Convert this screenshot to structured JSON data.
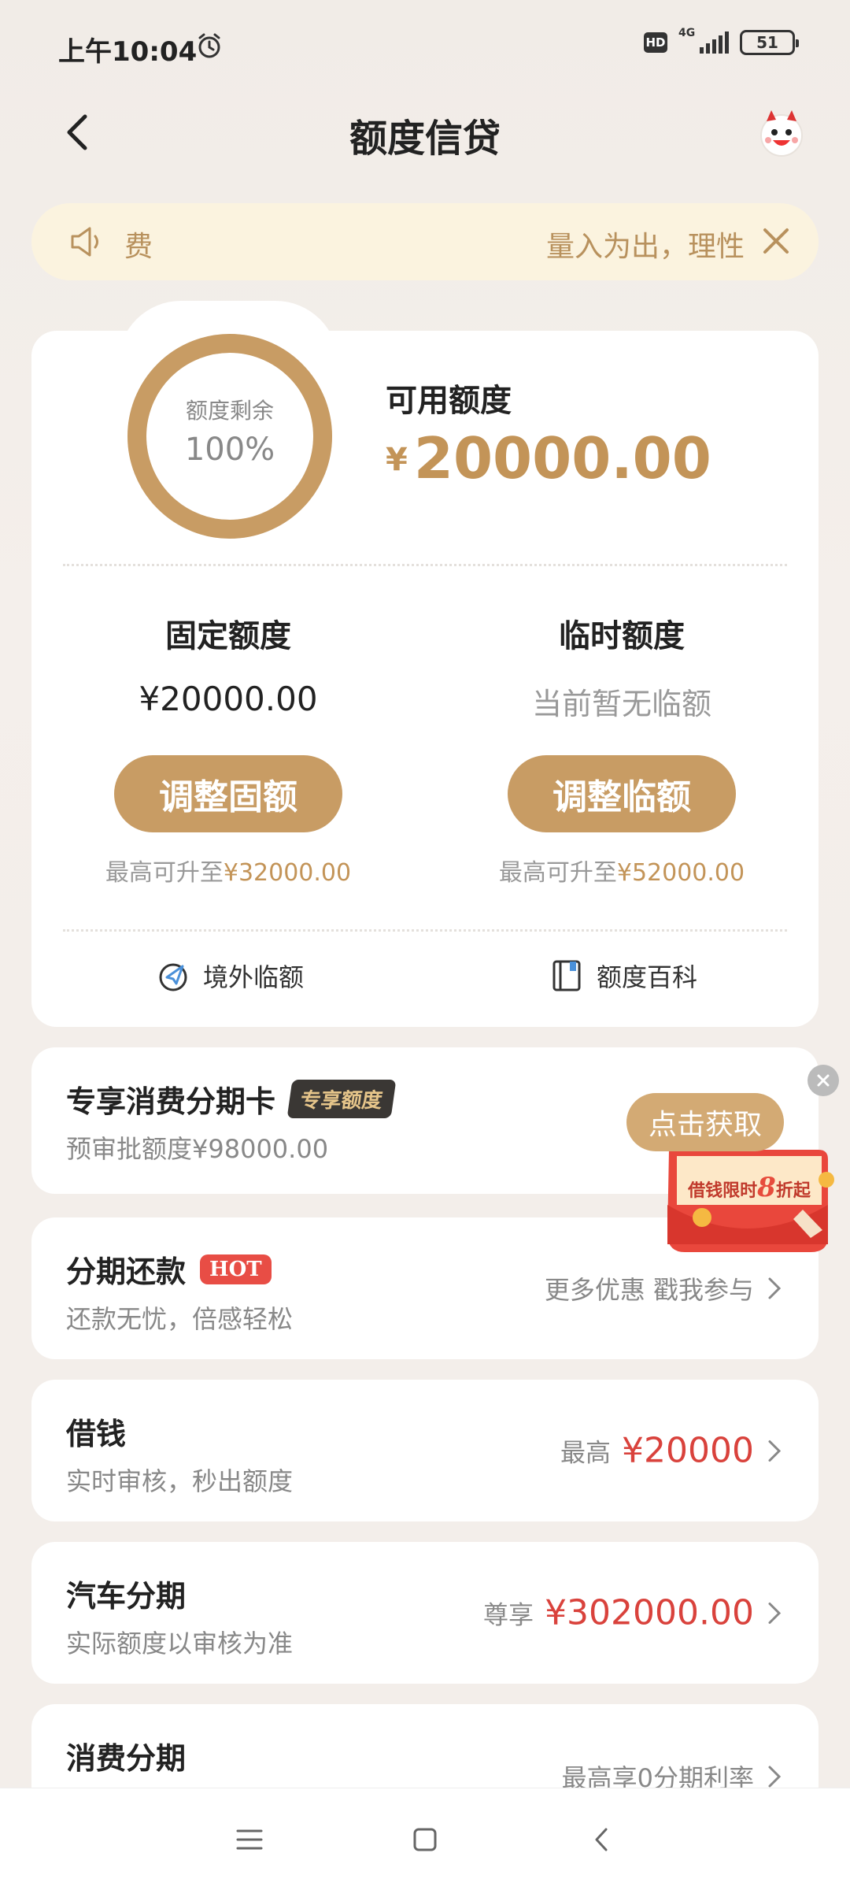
{
  "status_bar": {
    "time": "上午10:04",
    "hd": "HD",
    "network": "4G",
    "battery": "51"
  },
  "nav": {
    "title": "额度信贷"
  },
  "notice": {
    "text_left": "费",
    "text_right": "量入为出，理性"
  },
  "credit": {
    "ring_label": "额度剩余",
    "ring_value": "100%",
    "ring_fraction": 1.0,
    "available_label": "可用额度",
    "currency": "¥",
    "available_amount": "20000.00",
    "fixed": {
      "title": "固定额度",
      "value": "¥20000.00",
      "button": "调整固额",
      "max_prefix": "最高可升至",
      "max_amount": "¥32000.00"
    },
    "temp": {
      "title": "临时额度",
      "value": "当前暂无临额",
      "button": "调整临额",
      "max_prefix": "最高可升至",
      "max_amount": "¥52000.00"
    },
    "links": {
      "overseas": "境外临额",
      "wiki": "额度百科"
    }
  },
  "cards": {
    "installment_card": {
      "title": "专享消费分期卡",
      "badge": "专享额度",
      "sub": "预审批额度¥98000.00",
      "button": "点击获取"
    },
    "promo": {
      "text_prefix": "借钱限时",
      "big": "8",
      "text_suffix": "折起"
    },
    "installment_repay": {
      "title": "分期还款",
      "badge": "HOT",
      "sub": "还款无忧，倍感轻松",
      "right": "更多优惠 戳我参与"
    },
    "borrow": {
      "title": "借钱",
      "sub": "实时审核，秒出额度",
      "pre": "最高",
      "amount": "¥20000"
    },
    "car": {
      "title": "汽车分期",
      "sub": "实际额度以审核为准",
      "pre": "尊享",
      "amount": "¥302000.00"
    },
    "consume": {
      "title": "消费分期",
      "right": "最高享0分期利率"
    }
  },
  "colors": {
    "gold": "#c89c64",
    "red": "#d9423c",
    "notice_bg": "#fbf3df"
  }
}
